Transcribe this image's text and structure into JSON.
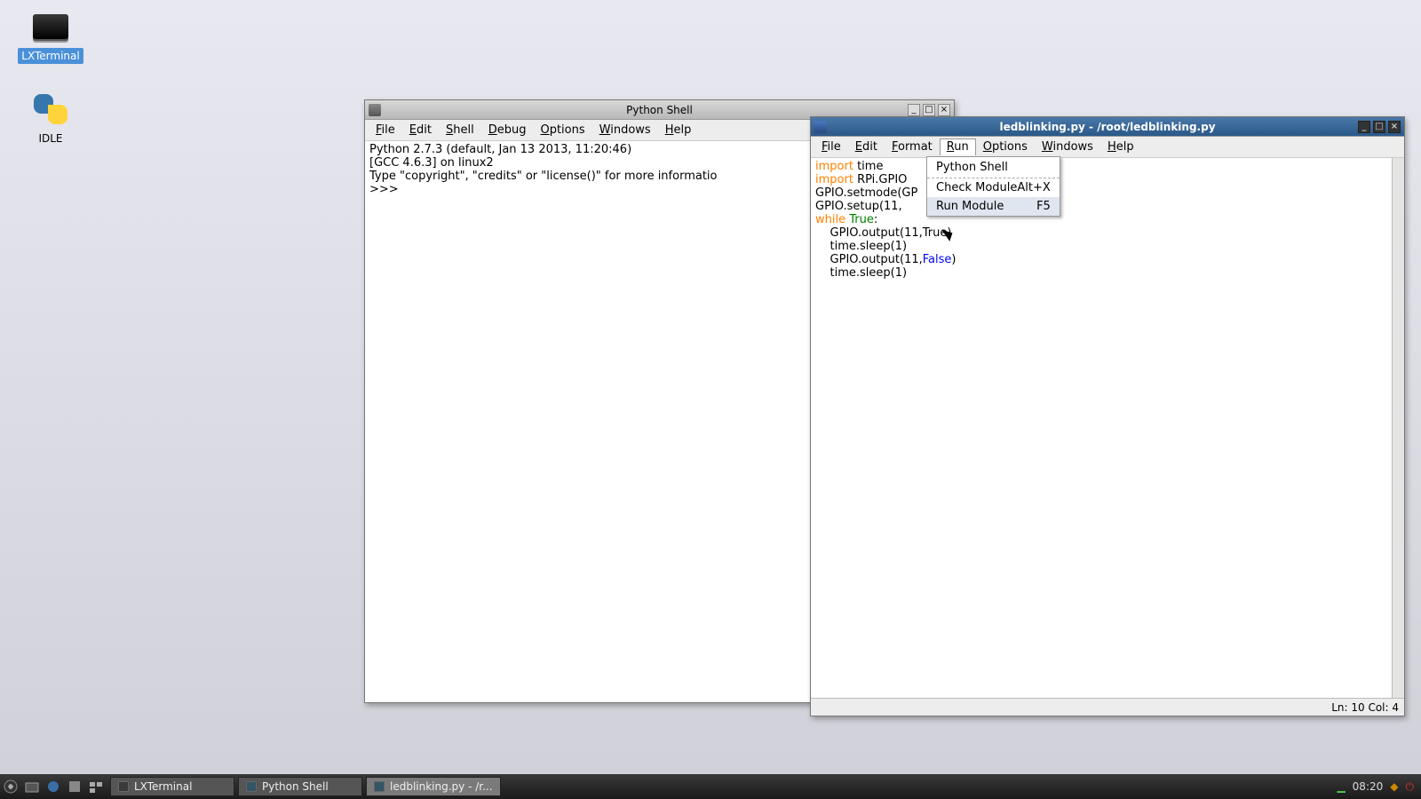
{
  "desktop": {
    "terminal_label": "LXTerminal",
    "idle_label": "IDLE"
  },
  "shell_window": {
    "title": "Python Shell",
    "menus": {
      "file": "File",
      "edit": "Edit",
      "shell": "Shell",
      "debug": "Debug",
      "options": "Options",
      "windows": "Windows",
      "help": "Help"
    },
    "body_line1": "Python 2.7.3 (default, Jan 13 2013, 11:20:46)",
    "body_line2": "[GCC 4.6.3] on linux2",
    "body_line3": "Type \"copyright\", \"credits\" or \"license()\" for more informatio",
    "prompt": ">>> "
  },
  "editor_window": {
    "title": "ledblinking.py - /root/ledblinking.py",
    "menus": {
      "file": "File",
      "edit": "Edit",
      "format": "Format",
      "run": "Run",
      "options": "Options",
      "windows": "Windows",
      "help": "Help"
    },
    "code": {
      "l1a": "import",
      "l1b": " time",
      "l2a": "import",
      "l2b": " RPi.GPIO",
      "l3": "GPIO.setmode(GP",
      "l4": "GPIO.setup(11, ",
      "l5a": "while",
      "l5b": " ",
      "l5c": "True",
      "l5d": ":",
      "l6": "    GPIO.output(11,True)",
      "l7": "    time.sleep(1)",
      "l8a": "    GPIO.output(11,",
      "l8b": "False",
      "l8c": ")",
      "l9": "    time.sleep(1)"
    },
    "status": "Ln: 10 Col: 4"
  },
  "run_menu": {
    "header": "Python Shell",
    "check_label": "Check Module",
    "check_accel": "Alt+X",
    "run_label": "Run Module",
    "run_accel": "F5"
  },
  "taskbar": {
    "t1": "LXTerminal",
    "t2": "Python Shell",
    "t3": "ledblinking.py - /r...",
    "clock": "08:20"
  }
}
